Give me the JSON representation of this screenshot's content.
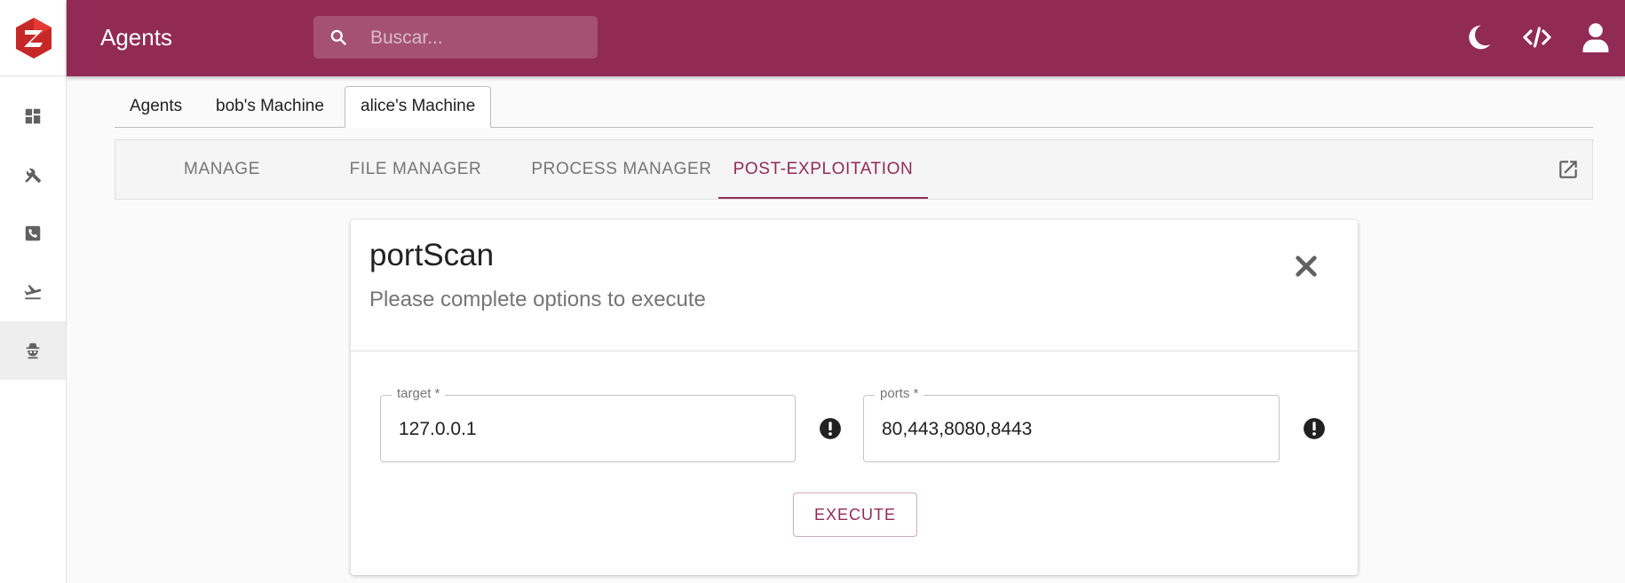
{
  "sidebar": {
    "logo_icon": "zimbra-like-hexagon-logo",
    "items": [
      {
        "icon": "dashboard-icon"
      },
      {
        "icon": "tools-icon"
      },
      {
        "icon": "phone-icon"
      },
      {
        "icon": "plane-takeoff-icon"
      },
      {
        "icon": "spy-icon"
      }
    ]
  },
  "header": {
    "title": "Agents",
    "search_placeholder": "Buscar...",
    "icons": [
      "moon-icon",
      "code-icon",
      "user-icon"
    ]
  },
  "agent_tabs": [
    {
      "label": "Agents"
    },
    {
      "label": "bob's Machine"
    },
    {
      "label": "alice's Machine"
    }
  ],
  "section_tabs": [
    {
      "label": "MANAGE"
    },
    {
      "label": "FILE MANAGER"
    },
    {
      "label": "PROCESS MANAGER"
    },
    {
      "label": "POST-EXPLOITATION"
    }
  ],
  "module": {
    "title": "portScan",
    "subtitle": "Please complete options to execute",
    "fields": [
      {
        "label": "target *",
        "value": "127.0.0.1"
      },
      {
        "label": "ports *",
        "value": "80,443,8080,8443"
      }
    ],
    "execute_label": "EXECUTE"
  },
  "colors": {
    "brand": "#912b55",
    "logo_red": "#c62828"
  }
}
